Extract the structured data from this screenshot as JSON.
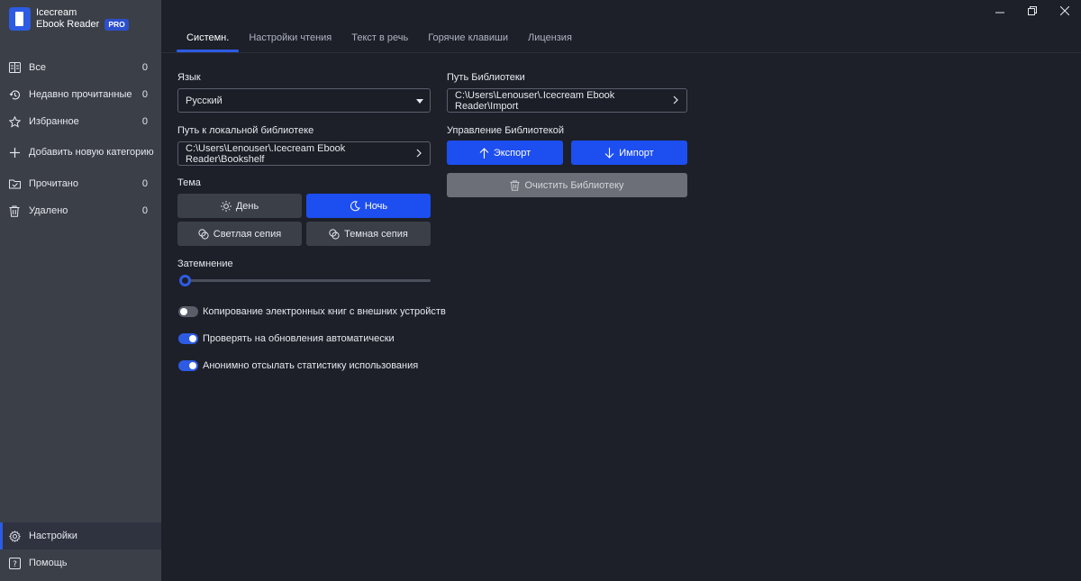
{
  "app": {
    "title_line1": "Icecream",
    "title_line2": "Ebook Reader",
    "badge": "PRO"
  },
  "sidebar": {
    "items": [
      {
        "label": "Все",
        "count": "0",
        "icon": "library-icon"
      },
      {
        "label": "Недавно прочитанные",
        "count": "0",
        "icon": "history-icon"
      },
      {
        "label": "Избранное",
        "count": "0",
        "icon": "star-icon"
      },
      {
        "label": "Добавить новую категорию",
        "count": "",
        "icon": "plus-icon"
      },
      {
        "label": "Прочитано",
        "count": "0",
        "icon": "folder-check-icon"
      },
      {
        "label": "Удалено",
        "count": "0",
        "icon": "trash-icon"
      }
    ],
    "settings": "Настройки",
    "help": "Помощь"
  },
  "tabs": [
    "Системн.",
    "Настройки чтения",
    "Текст в речь",
    "Горячие клавиши",
    "Лицензия"
  ],
  "active_tab": 0,
  "language": {
    "label": "Язык",
    "value": "Русский"
  },
  "local_library": {
    "label": "Путь к локальной библиотеке",
    "value": "C:\\Users\\Lenouser\\.Icecream Ebook Reader\\Bookshelf"
  },
  "theme": {
    "label": "Тема",
    "day": "День",
    "night": "Ночь",
    "light_sepia": "Светлая сепия",
    "dark_sepia": "Темная сепия",
    "selected": "night"
  },
  "dimming": {
    "label": "Затемнение",
    "value": 0
  },
  "toggles": [
    {
      "label": "Копирование электронных книг с внешних устройств",
      "on": false
    },
    {
      "label": "Проверять на обновления автоматически",
      "on": true
    },
    {
      "label": "Анонимно отсылать статистику использования",
      "on": true
    }
  ],
  "library_path": {
    "label": "Путь Библиотеки",
    "value": "C:\\Users\\Lenouser\\.Icecream Ebook Reader\\Import"
  },
  "library_mgmt": {
    "label": "Управление Библиотекой",
    "export": "Экспорт",
    "import": "Импорт",
    "clear": "Очистить Библиотеку"
  },
  "colors": {
    "accent": "#2d5be3",
    "button_blue": "#1d4ef0",
    "sidebar_bg": "#3b3f48",
    "main_bg": "#1d2029"
  }
}
